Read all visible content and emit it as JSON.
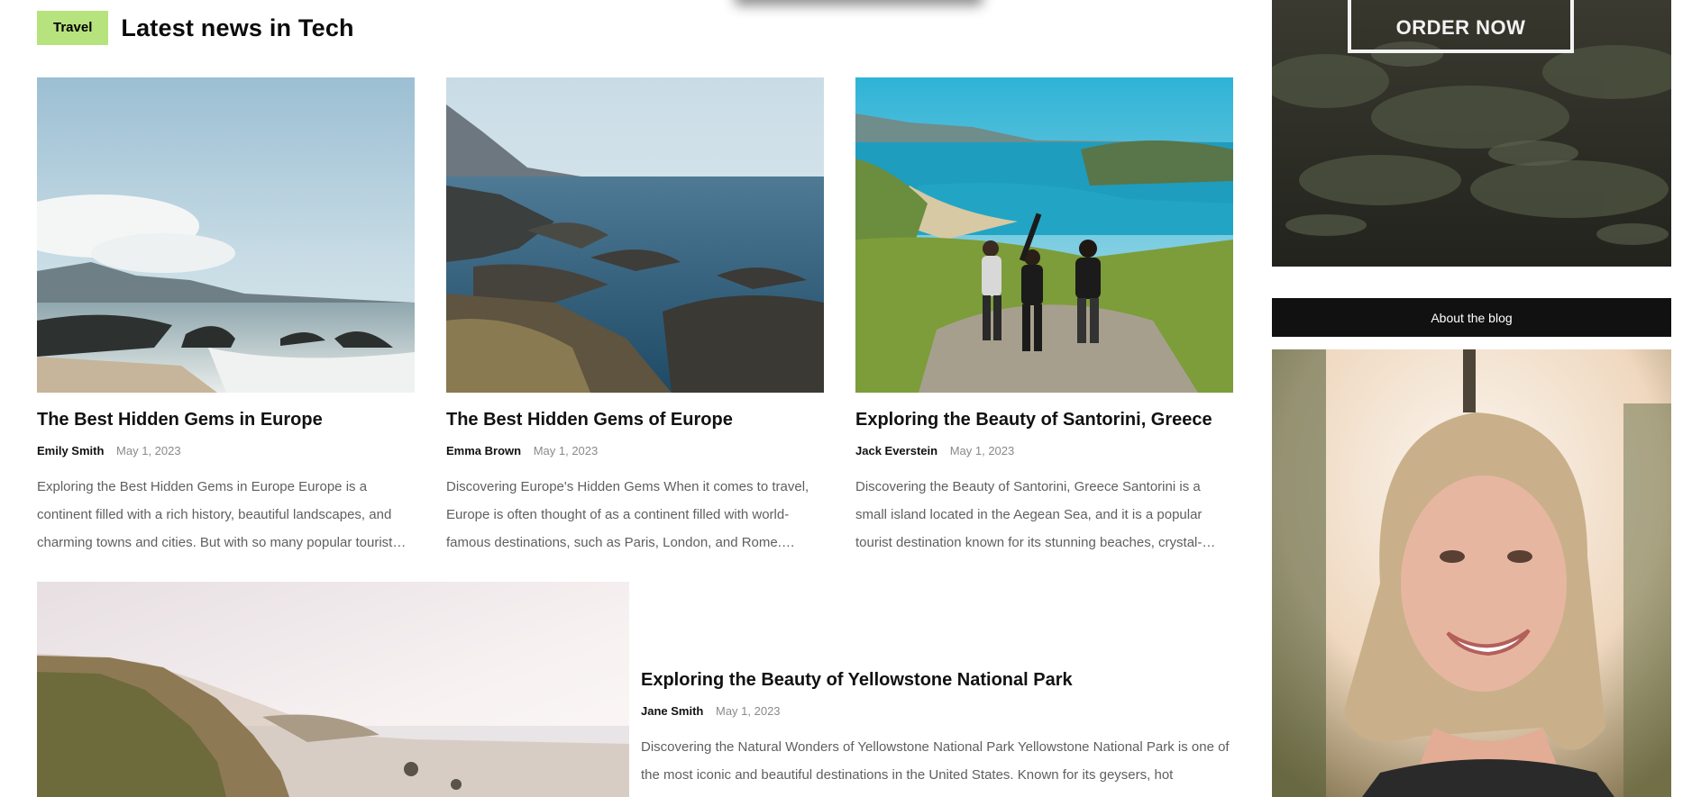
{
  "section": {
    "tag": "Travel",
    "title": "Latest news in Tech"
  },
  "posts": [
    {
      "title": "The Best Hidden Gems in Europe",
      "author": "Emily Smith",
      "date": "May 1, 2023",
      "excerpt": "Exploring the Best Hidden Gems in Europe Europe is a continent filled with a rich history, beautiful landscapes, and charming towns and cities. But with so many popular tourist…"
    },
    {
      "title": "The Best Hidden Gems of Europe",
      "author": "Emma Brown",
      "date": "May 1, 2023",
      "excerpt": "Discovering Europe's Hidden Gems When it comes to travel, Europe is often thought of as a continent filled with world-famous destinations, such as Paris, London, and Rome.…"
    },
    {
      "title": "Exploring the Beauty of Santorini, Greece",
      "author": "Jack Everstein",
      "date": "May 1, 2023",
      "excerpt": "Discovering the Beauty of Santorini, Greece Santorini is a small island located in the Aegean Sea, and it is a popular tourist destination known for its stunning beaches, crystal-…"
    }
  ],
  "featured": {
    "title": "Exploring the Beauty of Yellowstone National Park",
    "author": "Jane Smith",
    "date": "May 1, 2023",
    "excerpt": "Discovering the Natural Wonders of Yellowstone National Park Yellowstone National Park is one of the most iconic and beautiful destinations in the United States. Known for its geysers, hot"
  },
  "sidebar": {
    "promo_button": "ORDER NOW",
    "about_title": "About the blog"
  },
  "colors": {
    "tag_bg": "#b7e37e",
    "about_bar_bg": "#111111",
    "excerpt_text": "#5f5f5f",
    "date_text": "#8a8a8a"
  }
}
